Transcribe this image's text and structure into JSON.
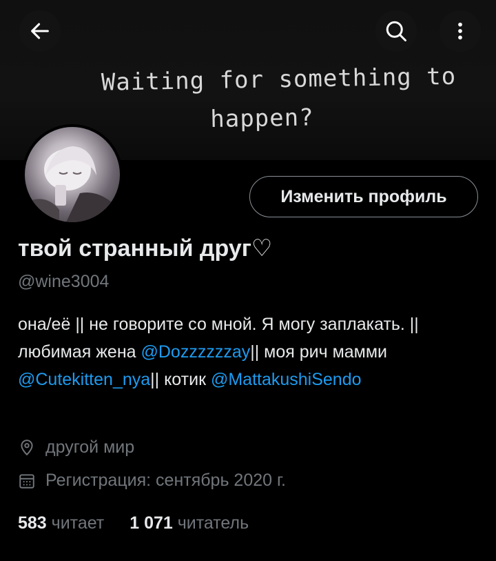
{
  "banner": {
    "line1": "Waiting for something to",
    "line2": "happen?"
  },
  "profile": {
    "edit_button": "Изменить профиль",
    "display_name": "твой странный друг♡",
    "handle": "@wine3004",
    "bio": {
      "part1": "она/её || не говорите со мной. Я могу заплакать. || любимая жена ",
      "mention1": "@Dozzzzzzay",
      "part2": "|| моя рич мамми ",
      "mention2": "@Cutekitten_nya",
      "part3": "|| котик ",
      "mention3": "@MattakushiSendo"
    },
    "location": "другой мир",
    "joined": "Регистрация: сентябрь 2020 г.",
    "following_count": "583",
    "following_label": "читает",
    "followers_count": "1 071",
    "followers_label": "читатель"
  },
  "icons": {
    "back": "arrow-left-icon",
    "search": "search-icon",
    "more": "more-vertical-icon",
    "location": "location-pin-icon",
    "calendar": "calendar-icon"
  },
  "colors": {
    "background": "#000000",
    "text": "#e7e9ea",
    "muted": "#71767b",
    "link": "#1d9bf0"
  }
}
